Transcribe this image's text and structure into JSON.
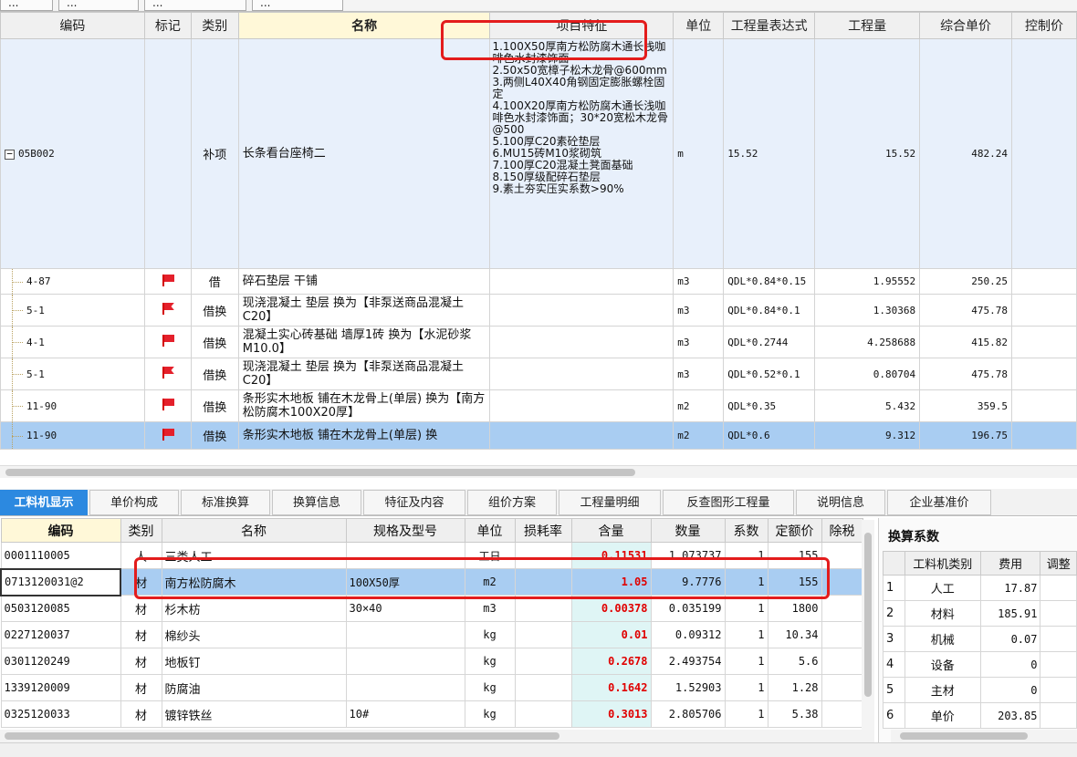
{
  "top_tabs": [
    "...",
    "...",
    "...",
    "..."
  ],
  "upper_grid": {
    "headers": {
      "code": "编码",
      "mark": "标记",
      "category": "类别",
      "name": "名称",
      "features": "项目特征",
      "unit": "单位",
      "expression": "工程量表达式",
      "quantity": "工程量",
      "unit_price": "综合单价",
      "control_price": "控制价"
    },
    "main_row": {
      "code": "05B002",
      "category": "补项",
      "name": "长条看台座椅二",
      "features": "1.100X50厚南方松防腐木通长浅咖啡色水封漆饰面\n2.50x50宽樟子松木龙骨@600mm\n3.两侧L40X40角钢固定膨胀螺栓固定\n4.100X20厚南方松防腐木通长浅咖啡色水封漆饰面；30*20宽松木龙骨@500\n5.100厚C20素砼垫层\n6.MU15砖M10浆砌筑\n7.100厚C20混凝土凳面基础\n8.150厚级配碎石垫层\n9.素土夯实压实系数>90%",
      "unit": "m",
      "expression": "15.52",
      "quantity": "15.52",
      "unit_price": "482.24"
    },
    "sub_rows": [
      {
        "code": "4-87",
        "flag": "red",
        "category": "借",
        "name": "碎石垫层 干铺",
        "unit": "m3",
        "expression": "QDL*0.84*0.15",
        "quantity": "1.95552",
        "unit_price": "250.25"
      },
      {
        "code": "5-1",
        "flag": "mixed",
        "category": "借换",
        "name": "现浇混凝土 垫层  换为【非泵送商品混凝土 C20】",
        "unit": "m3",
        "expression": "QDL*0.84*0.1",
        "quantity": "1.30368",
        "unit_price": "475.78"
      },
      {
        "code": "4-1",
        "flag": "red",
        "category": "借换",
        "name": "混凝土实心砖基础 墙厚1砖  换为【水泥砂浆 M10.0】",
        "unit": "m3",
        "expression": "QDL*0.2744",
        "quantity": "4.258688",
        "unit_price": "415.82"
      },
      {
        "code": "5-1",
        "flag": "mixed",
        "category": "借换",
        "name": "现浇混凝土 垫层  换为【非泵送商品混凝土 C20】",
        "unit": "m3",
        "expression": "QDL*0.52*0.1",
        "quantity": "0.80704",
        "unit_price": "475.78"
      },
      {
        "code": "11-90",
        "flag": "red",
        "category": "借换",
        "name": "条形实木地板 铺在木龙骨上(单层)  换为【南方松防腐木100X20厚】",
        "unit": "m2",
        "expression": "QDL*0.35",
        "quantity": "5.432",
        "unit_price": "359.5"
      },
      {
        "code": "11-90",
        "flag": "red",
        "category": "借换",
        "name": "条形实木地板 铺在木龙骨上(单层)  换",
        "unit": "m2",
        "expression": "QDL*0.6",
        "quantity": "9.312",
        "unit_price": "196.75"
      }
    ]
  },
  "bottom_tabs": [
    "工料机显示",
    "单价构成",
    "标准换算",
    "换算信息",
    "特征及内容",
    "组价方案",
    "工程量明细",
    "反查图形工程量",
    "说明信息",
    "企业基准价"
  ],
  "lower_grid": {
    "headers": {
      "code": "编码",
      "category": "类别",
      "name": "名称",
      "spec": "规格及型号",
      "unit": "单位",
      "loss_rate": "损耗率",
      "content": "含量",
      "amount": "数量",
      "coef": "系数",
      "fixed_price": "定额价",
      "tax": "除税"
    },
    "rows": [
      {
        "code": "0001110005",
        "category": "人",
        "name": "三类人工",
        "spec": "",
        "unit": "工日",
        "content": "0.11531",
        "amount": "1.073737",
        "coef": "1",
        "fixed_price": "155"
      },
      {
        "code": "0713120031@2",
        "category": "材",
        "name": "南方松防腐木",
        "spec": "100X50厚",
        "unit": "m2",
        "content": "1.05",
        "amount": "9.7776",
        "coef": "1",
        "fixed_price": "155"
      },
      {
        "code": "0503120085",
        "category": "材",
        "name": "杉木枋",
        "spec": "30×40",
        "unit": "m3",
        "content": "0.00378",
        "amount": "0.035199",
        "coef": "1",
        "fixed_price": "1800"
      },
      {
        "code": "0227120037",
        "category": "材",
        "name": "棉纱头",
        "spec": "",
        "unit": "kg",
        "content": "0.01",
        "amount": "0.09312",
        "coef": "1",
        "fixed_price": "10.34"
      },
      {
        "code": "0301120249",
        "category": "材",
        "name": "地板钉",
        "spec": "",
        "unit": "kg",
        "content": "0.2678",
        "amount": "2.493754",
        "coef": "1",
        "fixed_price": "5.6"
      },
      {
        "code": "1339120009",
        "category": "材",
        "name": "防腐油",
        "spec": "",
        "unit": "kg",
        "content": "0.1642",
        "amount": "1.52903",
        "coef": "1",
        "fixed_price": "1.28"
      },
      {
        "code": "0325120033",
        "category": "材",
        "name": "镀锌铁丝",
        "spec": "10#",
        "unit": "kg",
        "content": "0.3013",
        "amount": "2.805706",
        "coef": "1",
        "fixed_price": "5.38"
      }
    ]
  },
  "right_panel": {
    "title": "换算系数",
    "headers": {
      "type": "工料机类别",
      "cost": "费用",
      "adjust": "调整"
    },
    "rows": [
      {
        "idx": "1",
        "type": "人工",
        "cost": "17.87"
      },
      {
        "idx": "2",
        "type": "材料",
        "cost": "185.91"
      },
      {
        "idx": "3",
        "type": "机械",
        "cost": "0.07"
      },
      {
        "idx": "4",
        "type": "设备",
        "cost": "0"
      },
      {
        "idx": "5",
        "type": "主材",
        "cost": "0"
      },
      {
        "idx": "6",
        "type": "单价",
        "cost": "203.85"
      }
    ]
  },
  "colors": {
    "accent": "#2c89e0",
    "selected_row": "#a9cdf2",
    "highlight_box": "#e31c1c",
    "qty_red": "#e00000"
  }
}
